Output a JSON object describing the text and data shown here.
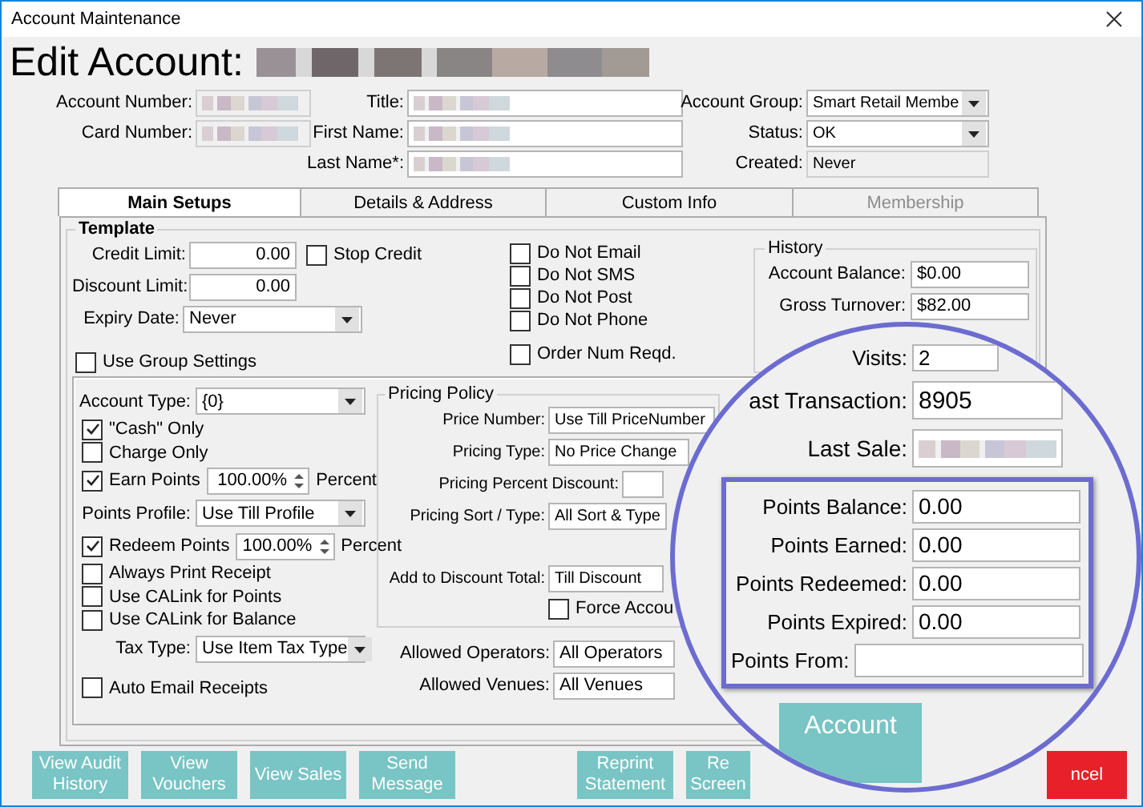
{
  "window": {
    "title": "Account Maintenance"
  },
  "heading": {
    "text": "Edit Account:",
    "blurred_name": true
  },
  "header": {
    "col1": [
      {
        "label": "Account Number:",
        "kind": "readonly",
        "blurred": true
      },
      {
        "label": "Card Number:",
        "kind": "readonly",
        "blurred": true
      }
    ],
    "col2": [
      {
        "label": "Title:",
        "kind": "text",
        "blurred": true
      },
      {
        "label": "First Name:",
        "kind": "text",
        "blurred": true
      },
      {
        "label": "Last Name*:",
        "kind": "text",
        "blurred": true
      }
    ],
    "col3": [
      {
        "label": "Account Group:",
        "kind": "select",
        "value": "Smart Retail Membe"
      },
      {
        "label": "Status:",
        "kind": "select",
        "value": "OK"
      },
      {
        "label": "Created:",
        "kind": "readonly",
        "value": "Never"
      }
    ]
  },
  "tabs": [
    {
      "label": "Main Setups",
      "selected": true,
      "disabled": false
    },
    {
      "label": "Details & Address",
      "selected": false,
      "disabled": false
    },
    {
      "label": "Custom Info",
      "selected": false,
      "disabled": false
    },
    {
      "label": "Membership",
      "selected": false,
      "disabled": true
    }
  ],
  "template": {
    "title": "Template",
    "limits": [
      {
        "label": "Credit Limit:",
        "value": "0.00"
      },
      {
        "label": "Discount Limit:",
        "value": "0.00"
      }
    ],
    "stop_credit": {
      "label": "Stop Credit",
      "checked": false
    },
    "expiry": {
      "label": "Expiry Date:",
      "value": "Never"
    },
    "contact": [
      {
        "label": "Do Not Email",
        "checked": false
      },
      {
        "label": "Do Not SMS",
        "checked": false
      },
      {
        "label": "Do Not Post",
        "checked": false
      },
      {
        "label": "Do Not Phone",
        "checked": false
      }
    ],
    "order_num": {
      "label": "Order Num Reqd.",
      "checked": false
    },
    "use_group_settings": {
      "label": "Use Group Settings",
      "checked": false
    },
    "history": {
      "title": "History",
      "rows": [
        {
          "label": "Account Balance:",
          "value": "$0.00"
        },
        {
          "label": "Gross Turnover:",
          "value": "$82.00"
        }
      ]
    },
    "options": [
      {
        "kind": "select",
        "label": "Account Type:",
        "value": "{0}"
      },
      {
        "kind": "check",
        "label": "\"Cash\" Only",
        "checked": true
      },
      {
        "kind": "check",
        "label": "Charge Only",
        "checked": false
      },
      {
        "kind": "spin",
        "label": "Earn Points",
        "checked": true,
        "value": "100.00%",
        "unit": "Percent"
      },
      {
        "kind": "select",
        "label": "Points Profile:",
        "value": "Use Till Profile"
      },
      {
        "kind": "spin",
        "label": "Redeem Points",
        "checked": true,
        "value": "100.00%",
        "unit": "Percent"
      },
      {
        "kind": "check",
        "label": "Always Print Receipt",
        "checked": false
      },
      {
        "kind": "check",
        "label": "Use CALink for Points",
        "checked": false
      },
      {
        "kind": "check",
        "label": "Use CALink for Balance",
        "checked": false
      },
      {
        "kind": "select",
        "label": "Tax Type:",
        "value": "Use Item Tax Type"
      },
      {
        "kind": "check",
        "label": "Auto Email Receipts",
        "checked": false
      }
    ],
    "pricing": {
      "title": "Pricing Policy",
      "rows": [
        {
          "kind": "select",
          "label": "Price Number:",
          "value": "Use Till PriceNumber"
        },
        {
          "kind": "select",
          "label": "Pricing Type:",
          "value": "No Price Change"
        },
        {
          "kind": "text",
          "label": "Pricing Percent Discount:"
        },
        {
          "kind": "select",
          "label": "Pricing Sort / Type:",
          "value": "All Sort & Type"
        }
      ],
      "discount_total": {
        "label": "Add to Discount Total:",
        "value": "Till Discount"
      },
      "force_account": {
        "label": "Force Accou",
        "checked": false
      }
    },
    "access": [
      {
        "label": "Allowed Operators:",
        "value": "All Operators"
      },
      {
        "label": "Allowed Venues:",
        "value": "All Venues"
      }
    ]
  },
  "magnifier": {
    "rows": [
      {
        "kind": "small",
        "label": "Visits:",
        "value": "2"
      },
      {
        "kind": "large",
        "label": "ast Transaction:",
        "value": "8905"
      },
      {
        "kind": "large",
        "label": "Last Sale:",
        "blurred": true
      }
    ],
    "points": [
      {
        "kind": "right",
        "label": "Points Balance:",
        "value": "0.00"
      },
      {
        "kind": "right",
        "label": "Points Earned:",
        "value": "0.00"
      },
      {
        "kind": "right",
        "label": "Points Redeemed:",
        "value": "0.00"
      },
      {
        "kind": "right",
        "label": "Points Expired:",
        "value": "0.00"
      },
      {
        "kind": "from",
        "label": "Points From:"
      }
    ],
    "button": {
      "label": "Account"
    }
  },
  "buttons": [
    {
      "label": "View Audit History",
      "kind": "action"
    },
    {
      "label": "View Vouchers",
      "kind": "action"
    },
    {
      "label": "View Sales",
      "kind": "action"
    },
    {
      "label": "Send Message",
      "kind": "action"
    },
    {
      "label": "Reprint Statement",
      "kind": "action"
    },
    {
      "label": "Re Screen",
      "kind": "action"
    },
    {
      "label": "ncel",
      "kind": "danger"
    }
  ]
}
